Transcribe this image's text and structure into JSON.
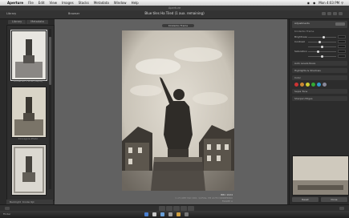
{
  "menubar": {
    "apple_glyph": "",
    "items": [
      "Aperture",
      "File",
      "Edit",
      "View",
      "Images",
      "Stacks",
      "Metadata",
      "Window",
      "Help"
    ],
    "clock": "Mon 4:03 PM"
  },
  "window": {
    "title": "Aperture"
  },
  "toolbar": {
    "library_tab": "Library",
    "browser_label": "Browser",
    "viewer_title": "Blue tiles Ha Tiled (1 aux. remaining)"
  },
  "left_panel": {
    "tabs": [
      "Library",
      "Metadata"
    ],
    "thumbnails": [
      {
        "label": "Kinderiko Frame (Sepia)",
        "selected": true
      },
      {
        "label": "Kinnagore Photo",
        "selected": false
      },
      {
        "label": "",
        "selected": false
      }
    ],
    "hud": [
      "Backlight",
      "Kinderdijk"
    ]
  },
  "viewer": {
    "photo_tag": "Kinderiko Frame",
    "meta_line1": "BBC 1024",
    "meta_line2": "1 of 1087 ISO 100, 1/250s, f/8 AUTO KINDERIKO FRAME A"
  },
  "inspector": {
    "header": "Adjustments",
    "header_sub": "Kinderiko Frame",
    "rows": [
      {
        "label": "Brightness",
        "value_pct": 55
      },
      {
        "label": "Contrast",
        "value_pct": 40
      },
      {
        "label": "",
        "value_pct": 50
      },
      {
        "label": "Saturation",
        "value_pct": 35
      },
      {
        "label": "",
        "value_pct": 50
      }
    ],
    "sections": [
      "Auto Levels Rows",
      "Highlights & Shadows",
      "Color",
      "Sepia Tone",
      "Sharpen Edges"
    ],
    "swatch_colors": [
      "#c33",
      "#c83",
      "#cc3",
      "#3a3",
      "#39c",
      "#889"
    ],
    "buttons": [
      "Reset",
      "Done"
    ],
    "preview_label": "Crop"
  },
  "dock": {
    "label": "Finder"
  }
}
